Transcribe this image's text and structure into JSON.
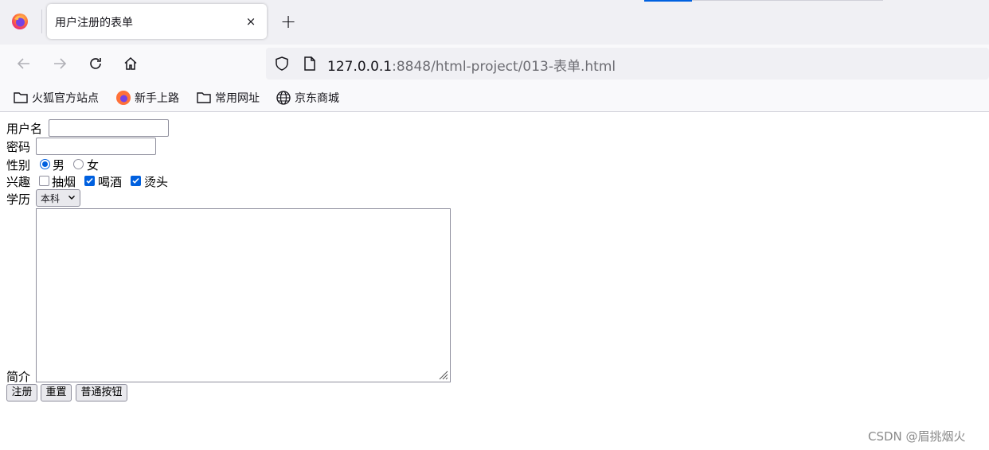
{
  "browser": {
    "tab_title": "用户注册的表单",
    "tab_close": "×",
    "new_tab": "+",
    "url_host": "127.0.0.1",
    "url_rest": ":8848/html-project/013-表单.html",
    "bookmarks": [
      "火狐官方站点",
      "新手上路",
      "常用网址",
      "京东商城"
    ]
  },
  "form": {
    "username_label": "用户名",
    "username_value": "",
    "password_label": "密码",
    "password_value": "",
    "gender_label": "性别",
    "gender_options": [
      "男",
      "女"
    ],
    "gender_selected": "男",
    "hobby_label": "兴趣",
    "hobbies": [
      {
        "label": "抽烟",
        "checked": false
      },
      {
        "label": "喝酒",
        "checked": true
      },
      {
        "label": "烫头",
        "checked": true
      }
    ],
    "education_label": "学历",
    "education_value": "本科",
    "intro_label": "简介",
    "intro_value": "",
    "buttons": [
      "注册",
      "重置",
      "普通按钮"
    ]
  },
  "watermark": "CSDN @眉挑烟火",
  "colors": {
    "accent": "#0060df",
    "tabstrip": "#f0f0f4",
    "toolbar": "#f9f9fb"
  }
}
